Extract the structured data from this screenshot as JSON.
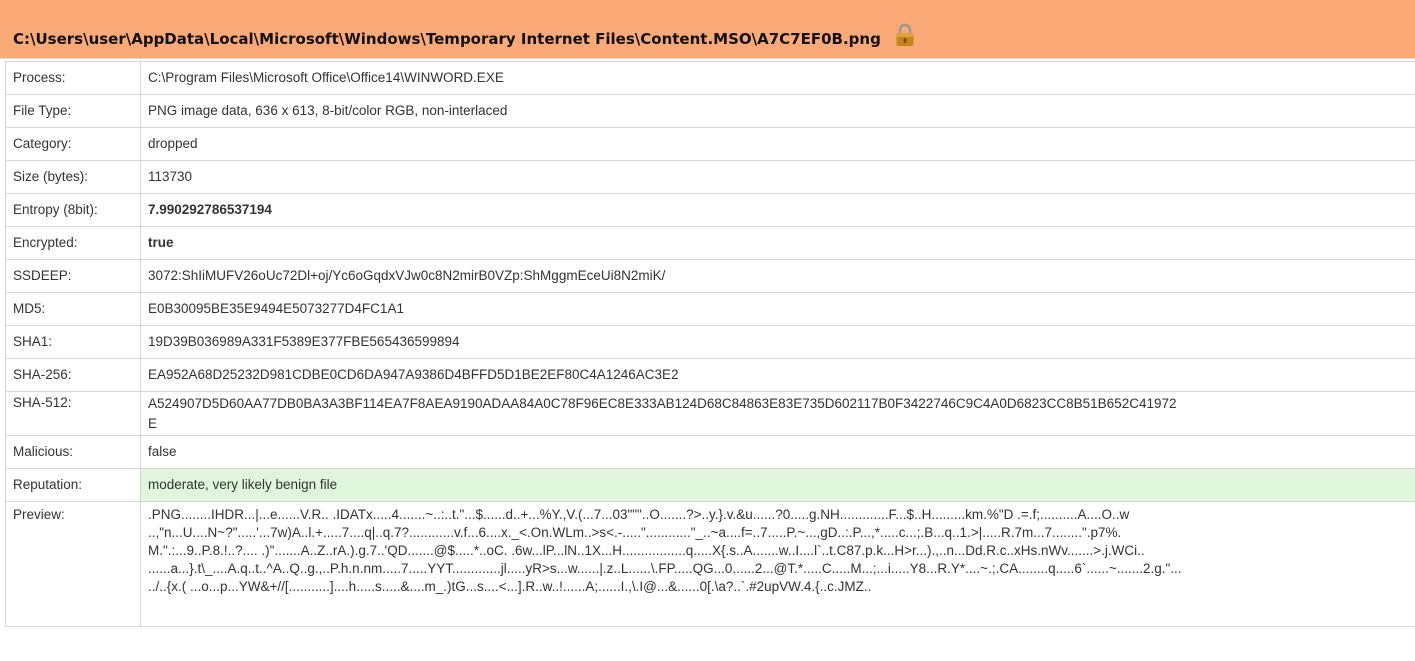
{
  "header": {
    "path": "C:\\Users\\user\\AppData\\Local\\Microsoft\\Windows\\Temporary Internet Files\\Content.MSO\\A7C7EF0B.png",
    "icon": "lock-icon",
    "background_color": "#fca978"
  },
  "rows": {
    "process": {
      "label": "Process:",
      "value": "C:\\Program Files\\Microsoft Office\\Office14\\WINWORD.EXE"
    },
    "file_type": {
      "label": "File Type:",
      "value": "PNG image data, 636 x 613, 8-bit/color RGB, non-interlaced"
    },
    "category": {
      "label": "Category:",
      "value": "dropped"
    },
    "size": {
      "label": "Size (bytes):",
      "value": "113730"
    },
    "entropy": {
      "label": "Entropy (8bit):",
      "value": "7.990292786537194"
    },
    "encrypted": {
      "label": "Encrypted:",
      "value": "true"
    },
    "ssdeep": {
      "label": "SSDEEP:",
      "value": "3072:ShIiMUFV26oUc72Dl+oj/Yc6oGqdxVJw0c8N2mirB0VZp:ShMggmEceUi8N2miK/"
    },
    "md5": {
      "label": "MD5:",
      "value": "E0B30095BE35E9494E5073277D4FC1A1"
    },
    "sha1": {
      "label": "SHA1:",
      "value": "19D39B036989A331F5389E377FBE565436599894"
    },
    "sha256": {
      "label": "SHA-256:",
      "value": "EA952A68D25232D981CDBE0CD6DA947A9386D4BFFD5D1BE2EF80C4A1246AC3E2"
    },
    "sha512": {
      "label": "SHA-512:",
      "value": "A524907D5D60AA77DB0BA3A3BF114EA7F8AEA9190ADAA84A0C78F96EC8E333AB124D68C84863E83E735D602117B0F3422746C9C4A0D6823CC8B51B652C41972E",
      "value_line1": "A524907D5D60AA77DB0BA3A3BF114EA7F8AEA9190ADAA84A0C78F96EC8E333AB124D68C84863E83E735D602117B0F3422746C9C4A0D6823CC8B51B652C41972",
      "value_line2": "E"
    },
    "malicious": {
      "label": "Malicious:",
      "value": "false"
    },
    "reputation": {
      "label": "Reputation:",
      "value": "moderate, very likely benign file",
      "highlight_color": "#dff6dc"
    },
    "preview": {
      "label": "Preview:",
      "lines": [
        ".PNG........IHDR...|...e......V.R.. .IDATx.....4.......~..:..t.\"...$......d..+...%Y.,V.(...7...03\"\"\"..O.......?>..y.}.v.&u......?0.....g.NH.............F...$..H.........km.%\"D .=.f;..........A....O..w",
        "..,\"n...U....N~?\".....'...7w)A..l.+.....7....q|..q.7?............v.f...6....x._<.On.WLm..>s<.-.....\"............\"_..~a....f=..7.....P.~...,gD..:.P...,*.....c...;.B...q..1.>|.....R.7m...7........\".p7%.",
        "M.\".:...9..P.8.!..?.... .)\".......A..Z..rA.).g.7..'QD.......@$.....*..oC. .6w...lP...lN..1X...H.................q.....X{.s..A.......w..I....l`..t.C87.p.k...H>r...).,..n...Dd.R.c..xHs.nWv.......>.j.WCi..",
        "......a...}.t\\_....A.q..t..^A..Q..g.,..P.h.n.nm.....7.....YYT.............jl.....yR>s...w......|.z..L......\\.FP.....QG...0......2...@T.*.....C.....M...;...i.....Y8...R.Y*....~.;.CA........q.....6`......~.......2.g.\"...",
        "../..{x.( ...o...p...YW&+//[...........]....h.....s.....&....m_.)tG...s....<...].R..w..!......A;......I.,\\.I@...&......0[.\\a?..`.#2upVW.4.{..c.JMZ.."
      ]
    }
  }
}
